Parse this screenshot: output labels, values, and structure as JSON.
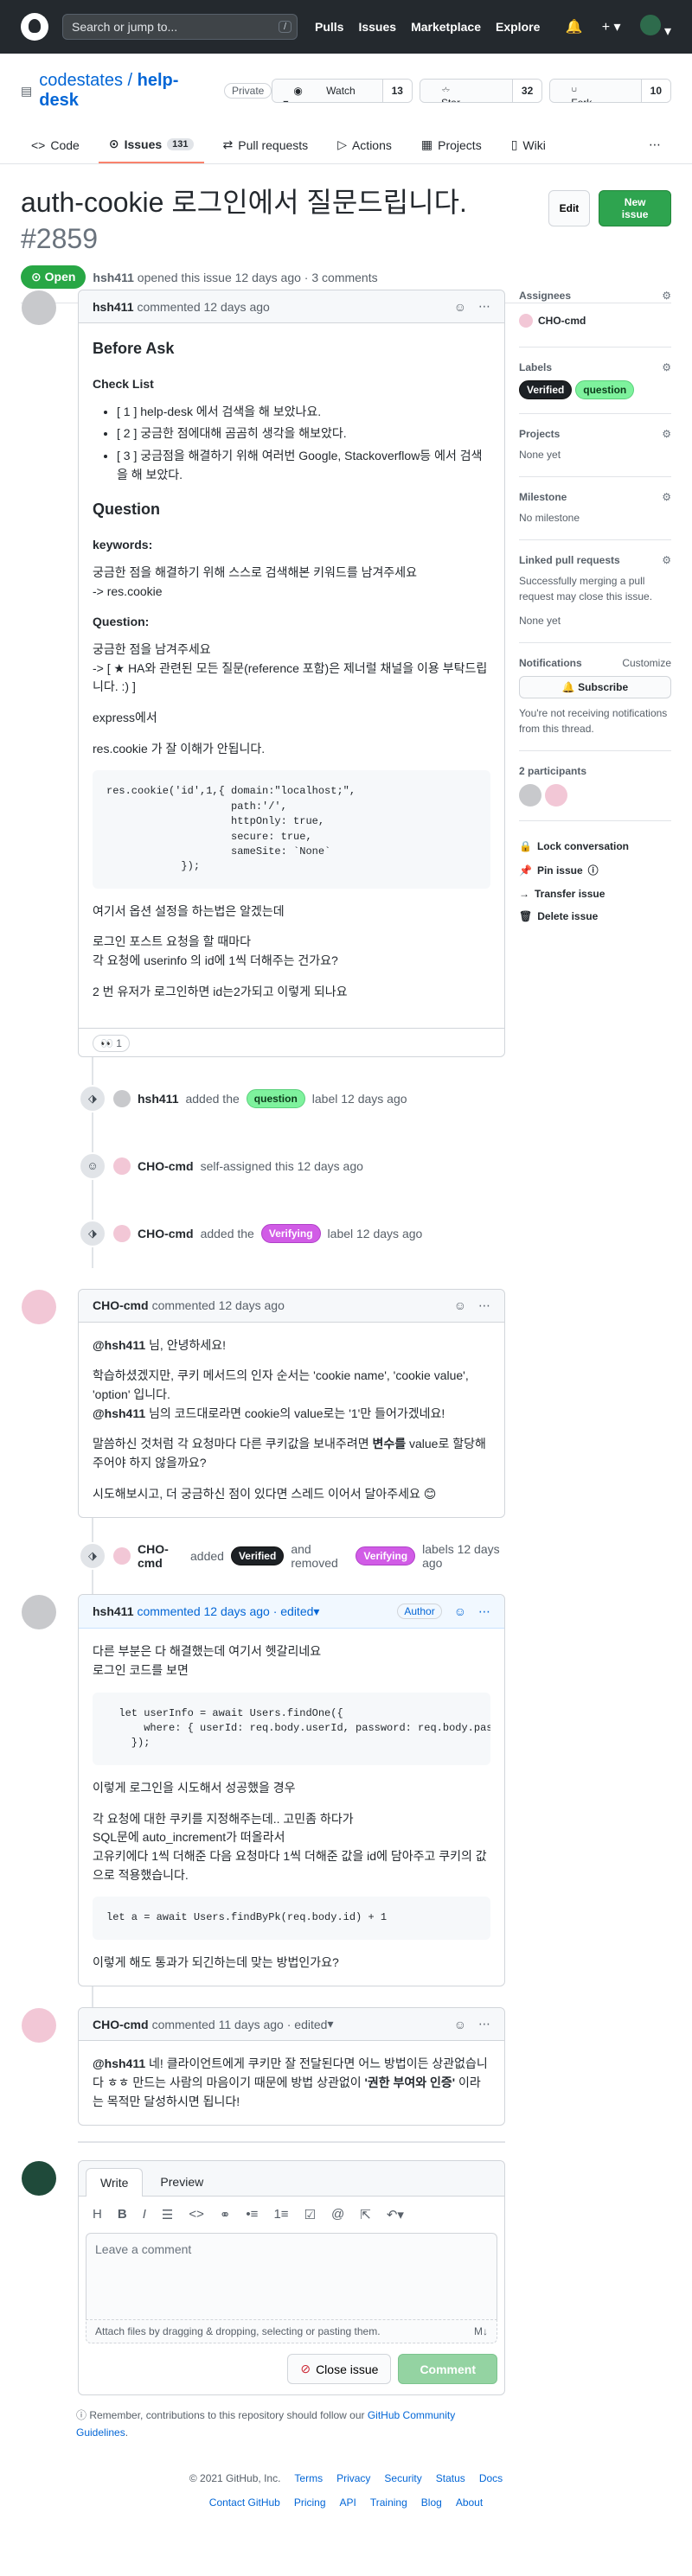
{
  "header": {
    "search_placeholder": "Search or jump to...",
    "slash": "/",
    "nav": [
      "Pulls",
      "Issues",
      "Marketplace",
      "Explore"
    ]
  },
  "repo": {
    "owner": "codestates",
    "name": "help-desk",
    "visibility": "Private",
    "watch": "Watch",
    "watch_count": "13",
    "star": "Star",
    "star_count": "32",
    "fork": "Fork",
    "fork_count": "10",
    "tabs": [
      {
        "label": "Code"
      },
      {
        "label": "Issues",
        "count": "131"
      },
      {
        "label": "Pull requests"
      },
      {
        "label": "Actions"
      },
      {
        "label": "Projects"
      },
      {
        "label": "Wiki"
      }
    ]
  },
  "issue": {
    "title": "auth-cookie 로그인에서 질문드립니다.",
    "number": "#2859",
    "edit": "Edit",
    "new_issue": "New issue",
    "state": "Open",
    "author": "hsh411",
    "meta": "opened this issue 12 days ago · 3 comments"
  },
  "c1": {
    "author": "hsh411",
    "time": "commented 12 days ago",
    "h_before": "Before Ask",
    "h_check": "Check List",
    "checks": [
      "[ 1 ] help-desk 에서 검색을 해 보았나요.",
      "[ 2 ] 궁금한 점에대해 곰곰히 생각을 해보았다.",
      "[ 3 ] 궁금점을 해결하기 위해 여러번 Google, Stackoverflow등 에서 검색을 해 보았다."
    ],
    "h_question": "Question",
    "h_keywords": "keywords:",
    "kw_text": "궁금한 점을 해결하기 위해 스스로 검색해본 키워드를 남겨주세요",
    "kw_value": "-> res.cookie",
    "h_question2": "Question:",
    "q_text": "궁금한 점을 남겨주세요",
    "q_note": "-> [ ★ HA와 관련된 모든 질문(reference 포함)은 제너럴 채널을 이용 부탁드립니다. :) ]",
    "p1": "express에서",
    "p2": "res.cookie 가 잘 이해가 안됩니다.",
    "code": [
      "res.cookie('id',1,{ domain:\"localhost;\",",
      "                    path:'/',",
      "                    httpOnly: true,",
      "                    secure: true,",
      "                    sameSite: `None`",
      "            });"
    ],
    "p3": "여기서 옵션 설정을 하는법은 알겠는데",
    "p4a": "로그인 포스트 요청을 할 때마다",
    "p4b": "각 요청에 userinfo 의 id에 1씩 더해주는 건가요?",
    "p5": "2 번 유저가 로그인하면 id는2가되고 이렇게 되나요",
    "reaction": "👀 1"
  },
  "events1": [
    {
      "user": "hsh411",
      "pre": "added the",
      "label": "question",
      "post": "label 12 days ago"
    },
    {
      "user": "CHO-cmd",
      "pre": "self-assigned this 12 days ago",
      "label": "",
      "post": ""
    },
    {
      "user": "CHO-cmd",
      "pre": "added the",
      "label": "Verifying",
      "post": "label 12 days ago"
    }
  ],
  "c2": {
    "author": "CHO-cmd",
    "time": "commented 12 days ago",
    "mention": "@hsh411",
    "greet": " 님, 안녕하세요!",
    "p1": "학습하셨겠지만, 쿠키 메서드의 인자 순서는 'cookie name', 'cookie value', 'option' 입니다.",
    "p2b": " 님의 코드대로라면 cookie의 value로는 '1'만 들어가겠네요!",
    "p3a": "말씀하신 것처럼 각 요청마다 다른 쿠키값을 보내주려면 ",
    "p3b": "변수를",
    "p3c": " value로 할당해주어야 하지 않을까요?",
    "p4": "시도해보시고, 더 궁금하신 점이 있다면 스레드 이어서 달아주세요 😊"
  },
  "event2": {
    "user": "CHO-cmd",
    "pre": "added",
    "label1": "Verified",
    "mid": "and removed",
    "label2": "Verifying",
    "post": "labels 12 days ago"
  },
  "c3": {
    "author": "hsh411",
    "time": "commented 12 days ago · edited",
    "badge": "Author",
    "p1": "다른 부분은 다 해결했는데 여기서 헷갈리네요",
    "p2": "로그인 코드를 보면",
    "code1": [
      "  let userInfo = await Users.findOne({",
      "      where: { userId: req.body.userId, password: req.body.passw",
      "    });"
    ],
    "p3": "이렇게 로그인을 시도해서 성공했을 경우",
    "p4a": "각 요청에 대한 쿠키를 지정해주는데.. 고민좀 하다가",
    "p4b": "SQL문에 auto_increment가 떠올라서",
    "p4c": "고유키에다 1씩 더해준 다음 요청마다 1씩 더해준 값을 id에 담아주고 쿠키의 값으로 적용했습니다.",
    "code2": "let a = await Users.findByPk(req.body.id) + 1",
    "p5": "이렇게 해도 통과가 되긴하는데 맞는 방법인가요?"
  },
  "c4": {
    "author": "CHO-cmd",
    "time": "commented 11 days ago · edited",
    "mention": "@hsh411",
    "t1": " 네! 클라이언트에게 쿠키만 잘 전달된다면 어느 방법이든 상관없습니다 ㅎㅎ 만드는 사람의 마음이기 때문에 방법 상관없이 ",
    "t2": "'권한 부여와 인증'",
    "t3": " 이라는 목적만 달성하시면 됩니다!"
  },
  "editor": {
    "write": "Write",
    "preview": "Preview",
    "placeholder": "Leave a comment",
    "attach": "Attach files by dragging & dropping, selecting or pasting them.",
    "close": "Close issue",
    "comment": "Comment",
    "tip1": "Remember, contributions to this repository should follow our ",
    "tip_link": "GitHub Community Guidelines",
    "tip2": "."
  },
  "sidebar": {
    "assignees": "Assignees",
    "assignee": "CHO-cmd",
    "labels": "Labels",
    "label1": "Verified",
    "label2": "question",
    "projects": "Projects",
    "projects_v": "None yet",
    "milestone": "Milestone",
    "milestone_v": "No milestone",
    "linked": "Linked pull requests",
    "linked_t": "Successfully merging a pull request may close this issue.",
    "linked_v": "None yet",
    "notifications": "Notifications",
    "customize": "Customize",
    "subscribe": "Subscribe",
    "notif_t": "You're not receiving notifications from this thread.",
    "participants": "2 participants",
    "lock": "Lock conversation",
    "pin": "Pin issue",
    "transfer": "Transfer issue",
    "delete": "Delete issue"
  },
  "footer": {
    "copy": "© 2021 GitHub, Inc.",
    "row1": [
      "Terms",
      "Privacy",
      "Security",
      "Status",
      "Docs"
    ],
    "row2": [
      "Contact GitHub",
      "Pricing",
      "API",
      "Training",
      "Blog",
      "About"
    ]
  }
}
